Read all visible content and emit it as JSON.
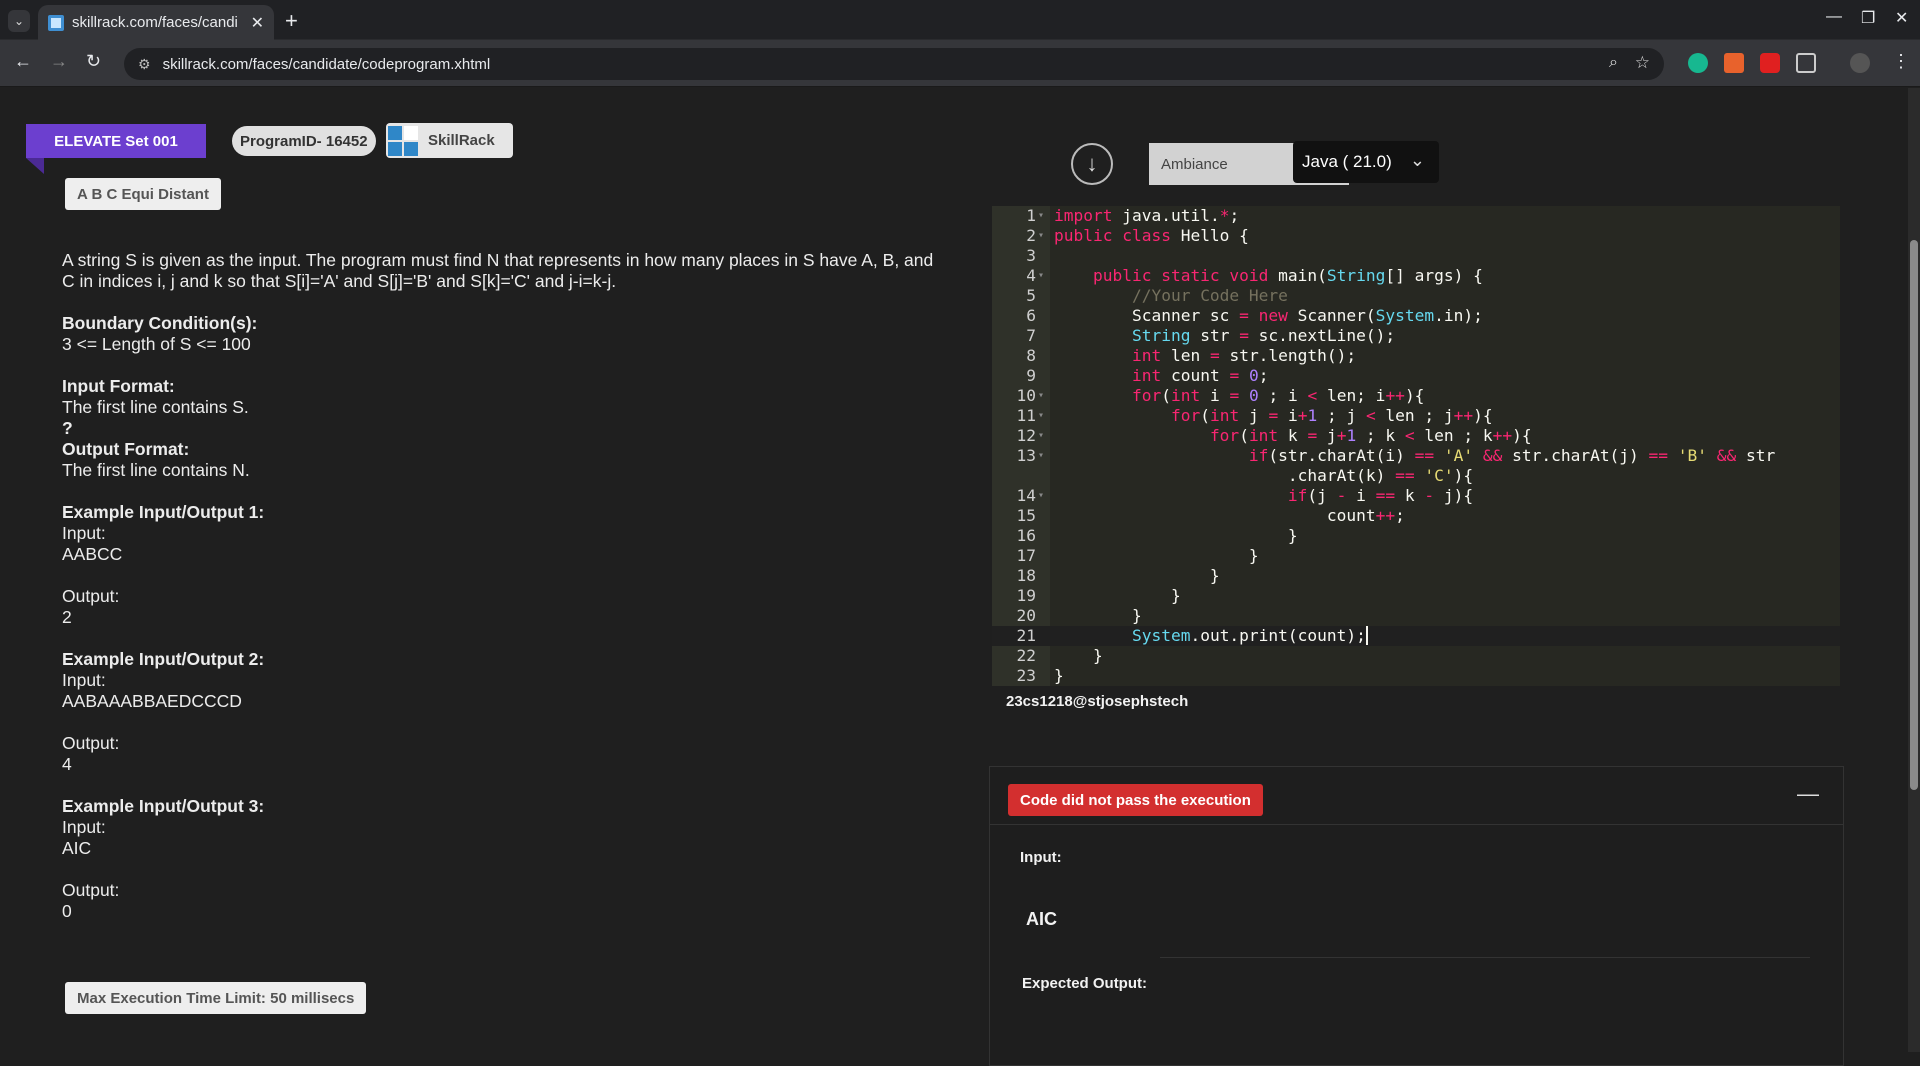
{
  "browser": {
    "tab_title": "skillrack.com/faces/candi",
    "url": "skillrack.com/faces/candidate/codeprogram.xhtml"
  },
  "header": {
    "set_name": "ELEVATE Set 001",
    "program_id": "ProgramID- 16452",
    "logo_text": "SkillRack"
  },
  "problem": {
    "title": "A B C Equi Distant",
    "statement": "A string S is given as the input. The program must find N that represents in how many places in S have A, B, and C in indices i, j and k so that S[i]='A' and S[j]='B' and S[k]='C' and j-i=k-j.",
    "boundary_heading": "Boundary Condition(s):",
    "boundary_text": "3 <= Length of S <= 100",
    "input_heading": "Input Format:",
    "input_text": "The first line contains S.",
    "question_mark": "?",
    "output_heading": "Output Format:",
    "output_text": "The first line contains N.",
    "examples": [
      {
        "heading": "Example Input/Output 1:",
        "input_label": "Input:",
        "input": "AABCC",
        "output_label": "Output:",
        "output": "2"
      },
      {
        "heading": "Example Input/Output 2:",
        "input_label": "Input:",
        "input": "AABAAABBAEDCCCD",
        "output_label": "Output:",
        "output": "4"
      },
      {
        "heading": "Example Input/Output 3:",
        "input_label": "Input:",
        "input": "AIC",
        "output_label": "Output:",
        "output": "0"
      }
    ],
    "max_time": "Max Execution Time Limit: 50 millisecs"
  },
  "editor": {
    "theme_label": "Ambiance",
    "language": "Java ( 21.0)"
  },
  "user_id": "23cs1218@stjosephstech",
  "result": {
    "status": "Code did not pass the execution",
    "input_label": "Input:",
    "input_value": "AIC",
    "expected_label": "Expected Output:"
  }
}
